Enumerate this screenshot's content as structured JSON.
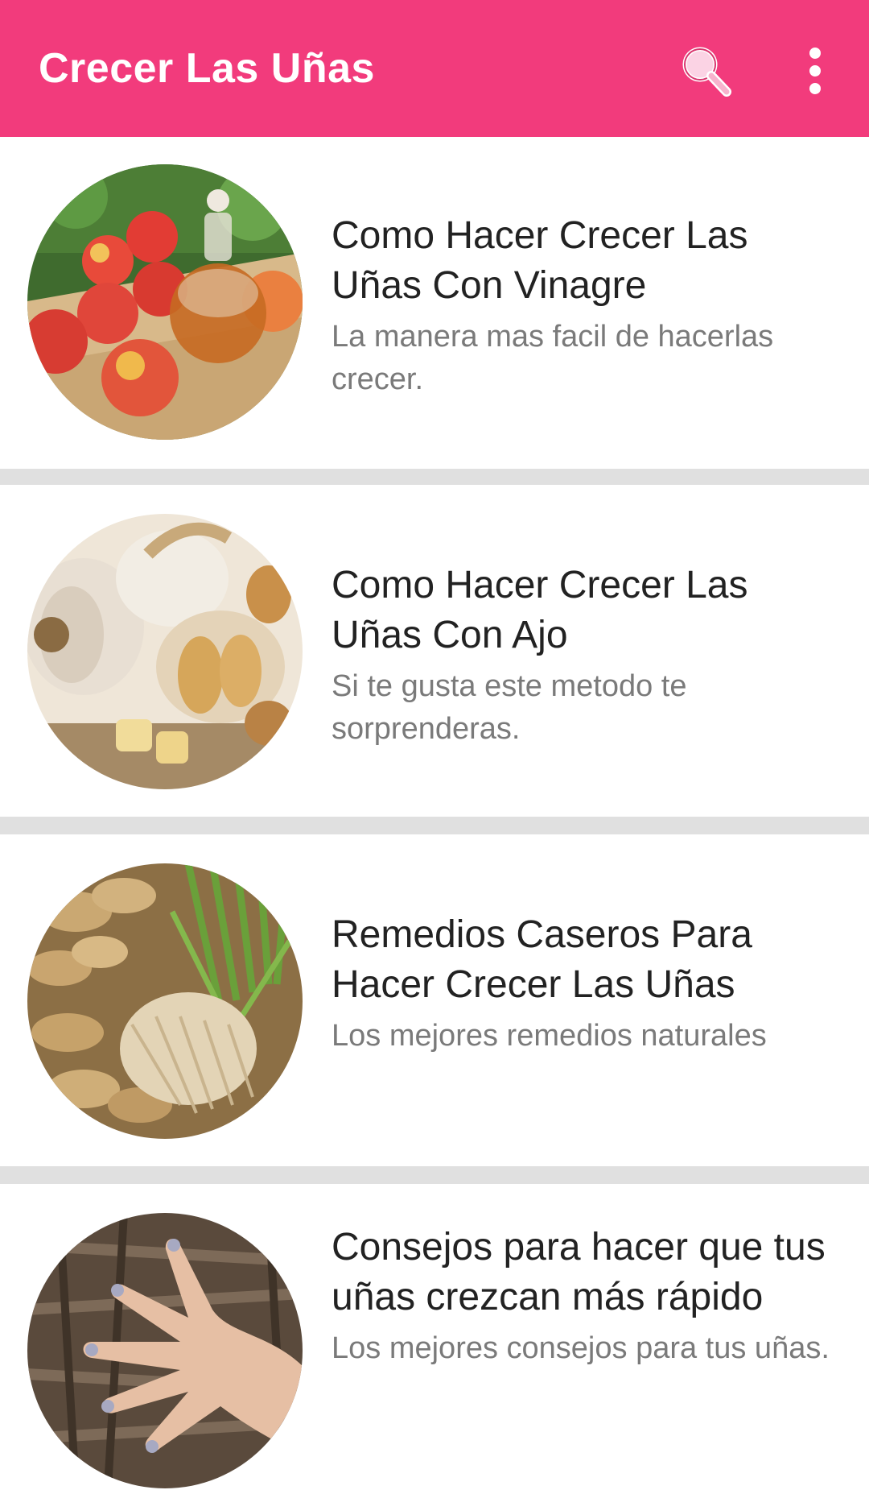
{
  "app_bar": {
    "title": "Crecer Las Uñas",
    "search_icon": "search-icon",
    "menu_icon": "overflow-menu-icon",
    "background_color": "#f23b7c"
  },
  "items": [
    {
      "title": "Como Hacer Crecer Las Uñas Con Vinagre",
      "subtitle": "La manera mas facil de hacerlas crecer.",
      "image": "apples-and-vinegar-photo"
    },
    {
      "title": "Como Hacer Crecer Las Uñas Con Ajo",
      "subtitle": "Si te gusta este metodo te sorprenderas.",
      "image": "garlic-photo"
    },
    {
      "title": "Remedios Caseros Para Hacer Crecer Las Uñas",
      "subtitle": "Los mejores remedios naturales",
      "image": "ginger-root-photo"
    },
    {
      "title": "Consejos para hacer que tus uñas crezcan más rápido",
      "subtitle": "Los mejores consejos para tus uñas.",
      "image": "hand-on-tree-bark-photo"
    }
  ]
}
